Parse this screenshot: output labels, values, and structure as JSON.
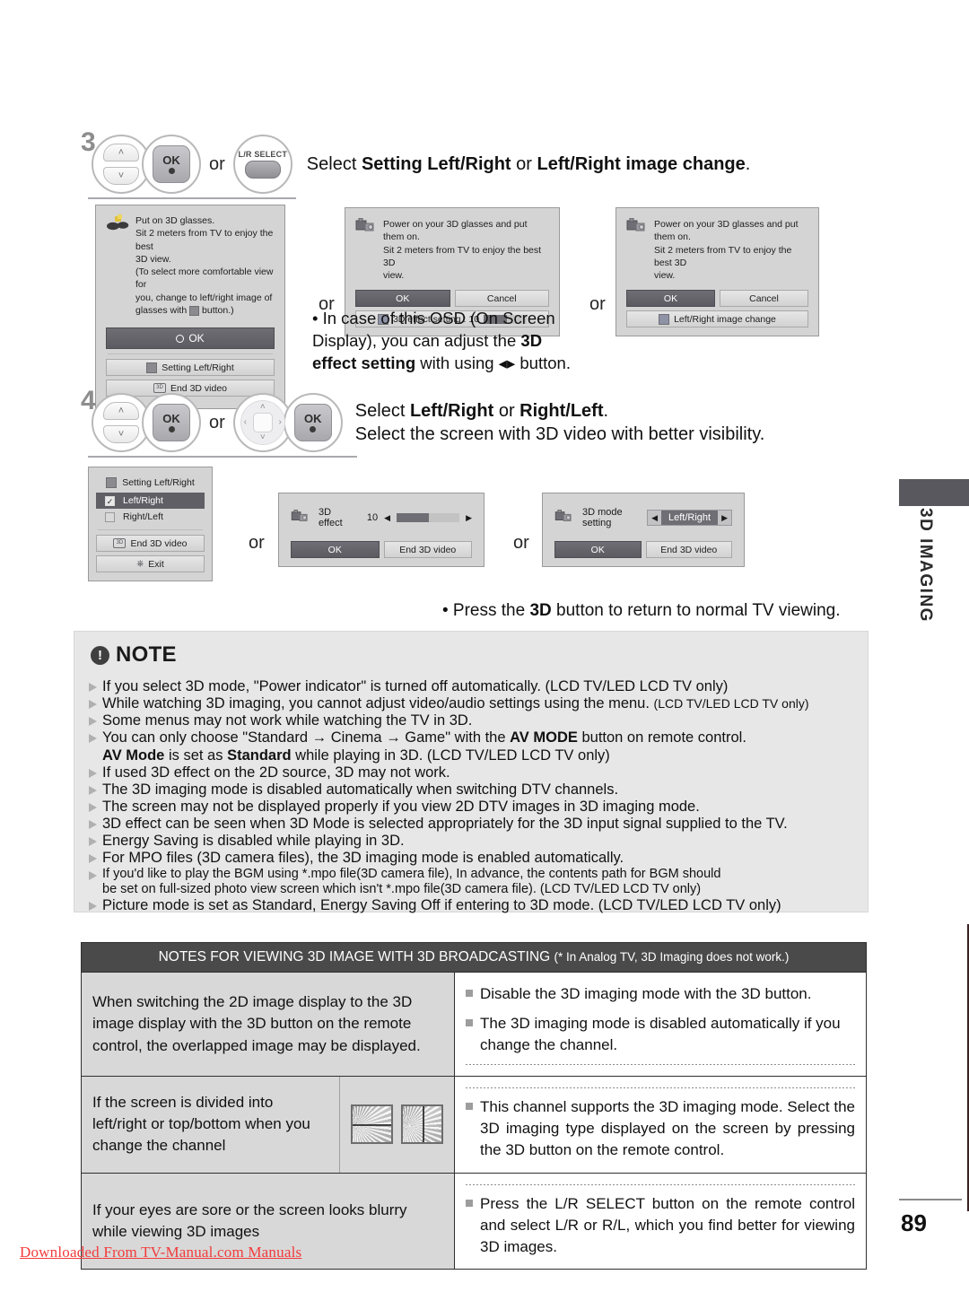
{
  "page": {
    "number": "89",
    "side_tab_label": "3D IMAGING",
    "watermark": "Downloaded From TV-Manual.com Manuals"
  },
  "steps": [
    {
      "num": "3",
      "controls": {
        "rocker_up": "˄",
        "rocker_down": "˅",
        "ok_label": "OK",
        "or_label": "or",
        "lr_select_label": "L/R SELECT"
      },
      "instruction_parts": [
        {
          "text": "Select ",
          "bold": false
        },
        {
          "text": "Setting Left/Right",
          "bold": true
        },
        {
          "text": " or ",
          "bold": false
        },
        {
          "text": "Left/Right image change",
          "bold": true
        },
        {
          "text": ".",
          "bold": false
        }
      ],
      "osd_left": {
        "icon": "3d-glasses-icon",
        "message_lines": [
          "Put on 3D glasses.",
          "Sit 2 meters from TV to enjoy the best",
          "3D view.",
          "(To select more comfortable view for",
          "you, change to left/right image of",
          "glasses with ■ button.)"
        ],
        "ok_label": "OK",
        "menu_items": [
          "Setting Left/Right",
          "End 3D video"
        ]
      },
      "or_1": "or",
      "osd_mid": {
        "icon": "3d-projector-icon",
        "message_lines": [
          "Power on your 3D glasses and put them on.",
          "Sit 2 meters from TV to enjoy the best 3D",
          "view."
        ],
        "ok_label": "OK",
        "cancel_label": "Cancel",
        "footer_label": "3D effect setting : 10",
        "effect_value": 10,
        "slider_fill_percent": 55
      },
      "or_2": "or",
      "osd_right": {
        "icon": "3d-projector-icon",
        "message_lines": [
          "Power on your 3D glasses and put them on.",
          "Sit 2 meters from TV to enjoy the best 3D",
          "view."
        ],
        "ok_label": "OK",
        "cancel_label": "Cancel",
        "footer_label": "Left/Right image change"
      },
      "note_parts": [
        {
          "text": "• In case of this OSD (On Screen",
          "bold": false
        },
        {
          "text": "\n",
          "bold": false
        },
        {
          "text": "   Display), you can adjust the ",
          "bold": false
        },
        {
          "text": "3D",
          "bold": true
        },
        {
          "text": "\n",
          "bold": false
        },
        {
          "text": "   ",
          "bold": false
        },
        {
          "text": "effect setting",
          "bold": true
        },
        {
          "text": " with using ◂▸ button.",
          "bold": false
        }
      ]
    },
    {
      "num": "4",
      "controls": {
        "rocker_up": "˄",
        "rocker_down": "˅",
        "ok_label": "OK",
        "or_label": "or",
        "dpad_up": "˄",
        "dpad_down": "˅",
        "dpad_left": "‹",
        "dpad_right": "›"
      },
      "instruction_line1_parts": [
        {
          "text": "Select ",
          "bold": false
        },
        {
          "text": "Left/Right",
          "bold": true
        },
        {
          "text": " or ",
          "bold": false
        },
        {
          "text": "Right/Left",
          "bold": true
        },
        {
          "text": ".",
          "bold": false
        }
      ],
      "instruction_line2": "Select the screen with 3D video with better visibility.",
      "osd_left": {
        "title": "Setting Left/Right",
        "options": [
          {
            "label": "Left/Right",
            "checked": true,
            "selected": true
          },
          {
            "label": "Right/Left",
            "checked": false,
            "selected": false
          }
        ],
        "buttons": [
          "End 3D video",
          "Exit"
        ]
      },
      "or_1": "or",
      "osd_mid": {
        "icon": "3d-projector-icon",
        "label": "3D effect",
        "value": "10",
        "left_arrow": "◀",
        "right_arrow": "▶",
        "slider_fill_percent": 52,
        "ok_label": "OK",
        "end_label": "End 3D video"
      },
      "or_2": "or",
      "osd_right": {
        "icon": "3d-projector-icon",
        "label": "3D mode setting",
        "value": "Left/Right",
        "left_arrow": "◀",
        "right_arrow": "▶",
        "ok_label": "OK",
        "end_label": "End 3D video"
      },
      "footnote_parts": [
        {
          "text": "• Press the ",
          "bold": false
        },
        {
          "text": "3D",
          "bold": true
        },
        {
          "text": " button to return to normal TV viewing.",
          "bold": false
        }
      ]
    }
  ],
  "note": {
    "title": "NOTE",
    "items": [
      {
        "html": "If you select 3D mode, \"Power indicator\" is turned off automatically. (LCD TV/LED LCD TV only)",
        "size": "normal"
      },
      {
        "html": "While watching 3D imaging, you cannot adjust video/audio settings using the menu. <span class=\"small\">(LCD TV/LED LCD TV only)</span>",
        "size": "normal"
      },
      {
        "html": "Some menus may not work while watching the TV in 3D.",
        "size": "normal"
      },
      {
        "html": "You can only choose \"Standard → Cinema → Game\" with the <b>AV MODE</b> button on remote control.<br><b>AV Mode</b> is set as <b>Standard</b> while playing in 3D. (LCD TV/LED LCD TV only)",
        "size": "normal"
      },
      {
        "html": "If used 3D effect on the 2D source, 3D may not work.",
        "size": "normal"
      },
      {
        "html": "The 3D imaging mode is disabled automatically when switching DTV channels.",
        "size": "normal"
      },
      {
        "html": "The screen may not be displayed properly if you view 2D DTV images in 3D imaging mode.",
        "size": "normal"
      },
      {
        "html": "3D effect can be seen when 3D Mode is selected appropriately for the 3D input signal supplied to the TV.",
        "size": "normal"
      },
      {
        "html": "Energy Saving is disabled while playing in 3D.",
        "size": "normal"
      },
      {
        "html": "For MPO files (3D camera files), the 3D imaging mode is enabled automatically.",
        "size": "normal"
      },
      {
        "html": "If you'd like to play the BGM using *.mpo file(3D camera file), In advance, the contents path for BGM should<br>be set on full-sized photo view screen which isn't *.mpo file(3D camera file). (LCD TV/LED LCD TV only)",
        "size": "sm"
      },
      {
        "html": "Picture mode is set as Standard, Energy Saving Off if entering to 3D mode. (LCD TV/LED LCD TV only)",
        "size": "normal"
      }
    ]
  },
  "bottom_table": {
    "header_main": "NOTES FOR VIEWING 3D IMAGE WITH 3D BROADCASTING",
    "header_sub": "(* In Analog TV, 3D Imaging does not work.)",
    "rows": [
      {
        "condition": "When switching the 2D image display to the 3D image display with the 3D button on the remote control, the overlapped image may be displayed.",
        "has_thumbnails": false,
        "actions": [
          "Disable the 3D imaging mode with the 3D button.",
          "The 3D imaging mode is disabled automatically if you change the channel."
        ]
      },
      {
        "condition": "If the screen is divided into left/right or top/bottom when you change the channel",
        "has_thumbnails": true,
        "actions": [
          "This channel supports the 3D imaging mode. Select the 3D imaging type displayed on the screen by pressing the 3D button on the remote control."
        ]
      },
      {
        "condition": "If your eyes are sore or the screen looks blurry while viewing 3D images",
        "has_thumbnails": false,
        "actions": [
          "Press the L/R SELECT button on the remote control and select L/R or R/L, which you find better for viewing 3D images."
        ]
      }
    ]
  },
  "colors": {
    "osd_bg": "#d4d4d4",
    "osd_dark_btn": "#5f5f65",
    "note_bg": "#e7e7e7",
    "table_header_bg": "#4a4a4a",
    "watermark": "#f23b3b"
  }
}
